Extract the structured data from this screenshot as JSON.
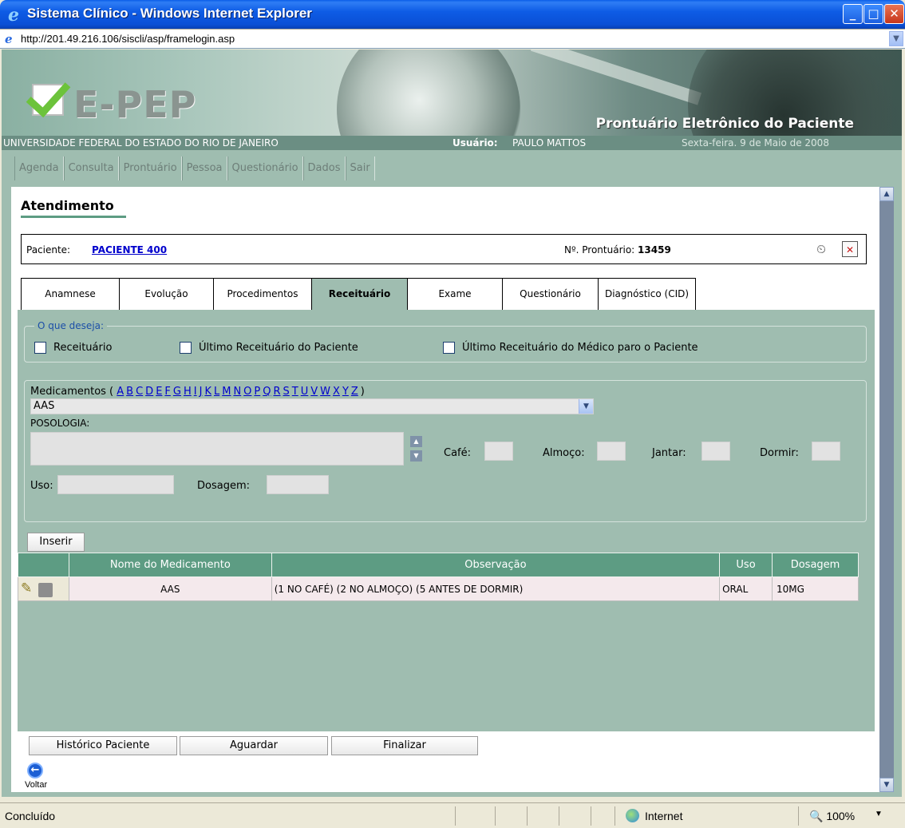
{
  "window": {
    "title": "Sistema Clínico - Windows Internet Explorer",
    "url": "http://201.49.216.106/siscli/asp/framelogin.asp"
  },
  "banner": {
    "logo_text": "E-PEP",
    "subtitle": "Prontuário Eletrônico do Paciente",
    "institution": "UNIVERSIDADE FEDERAL DO ESTADO DO RIO DE JANEIRO",
    "user_label": "Usuário:",
    "user_name": "PAULO MATTOS",
    "date": "Sexta-feira. 9 de Maio de 2008"
  },
  "menu": [
    "Agenda",
    "Consulta",
    "Prontuário",
    "Pessoa",
    "Questionário",
    "Dados",
    "Sair"
  ],
  "page": {
    "title": "Atendimento",
    "patient_label": "Paciente:",
    "patient_name": "PACIENTE 400",
    "prontuario_label": "Nº. Prontuário:",
    "prontuario_number": "13459"
  },
  "tabs": [
    "Anamnese",
    "Evolução",
    "Procedimentos",
    "Receituário",
    "Exame",
    "Questionário",
    "Diagnóstico (CID)"
  ],
  "active_tab": "Receituário",
  "options": {
    "legend": "O que deseja:",
    "checkboxes": [
      "Receituário",
      "Último Receituário do Paciente",
      "Último Receituário do Médico paro o Paciente"
    ]
  },
  "medicamentos": {
    "label_prefix": "Medicamentos (",
    "label_suffix": ")",
    "letters": [
      "A",
      "B",
      "C",
      "D",
      "E",
      "F",
      "G",
      "H",
      "I",
      "J",
      "K",
      "L",
      "M",
      "N",
      "O",
      "P",
      "Q",
      "R",
      "S",
      "T",
      "U",
      "V",
      "W",
      "X",
      "Y",
      "Z"
    ],
    "selected": "AAS",
    "posologia_label": "POSOLOGIA:",
    "cafe_label": "Café:",
    "almoco_label": "Almoço:",
    "jantar_label": "Jantar:",
    "dormir_label": "Dormir:",
    "uso_label": "Uso:",
    "dosagem_label": "Dosagem:",
    "inserir_label": "Inserir"
  },
  "table": {
    "headers": [
      "Nome do Medicamento",
      "Observação",
      "Uso",
      "Dosagem"
    ],
    "rows": [
      {
        "nome": "AAS",
        "obs": "(1 NO CAFÉ) (2 NO ALMOÇO) (5 ANTES DE DORMIR)",
        "uso": "ORAL",
        "dosagem": "10MG"
      }
    ]
  },
  "buttons": {
    "historico": "Histórico Paciente",
    "aguardar": "Aguardar",
    "finalizar": "Finalizar",
    "voltar": "Voltar"
  },
  "statusbar": {
    "text": "Concluído",
    "zone": "Internet",
    "zoom": "100%"
  },
  "colors": {
    "accent": "#5d9c83",
    "panel_bg": "#9fbdb0",
    "link": "#0000cc"
  }
}
